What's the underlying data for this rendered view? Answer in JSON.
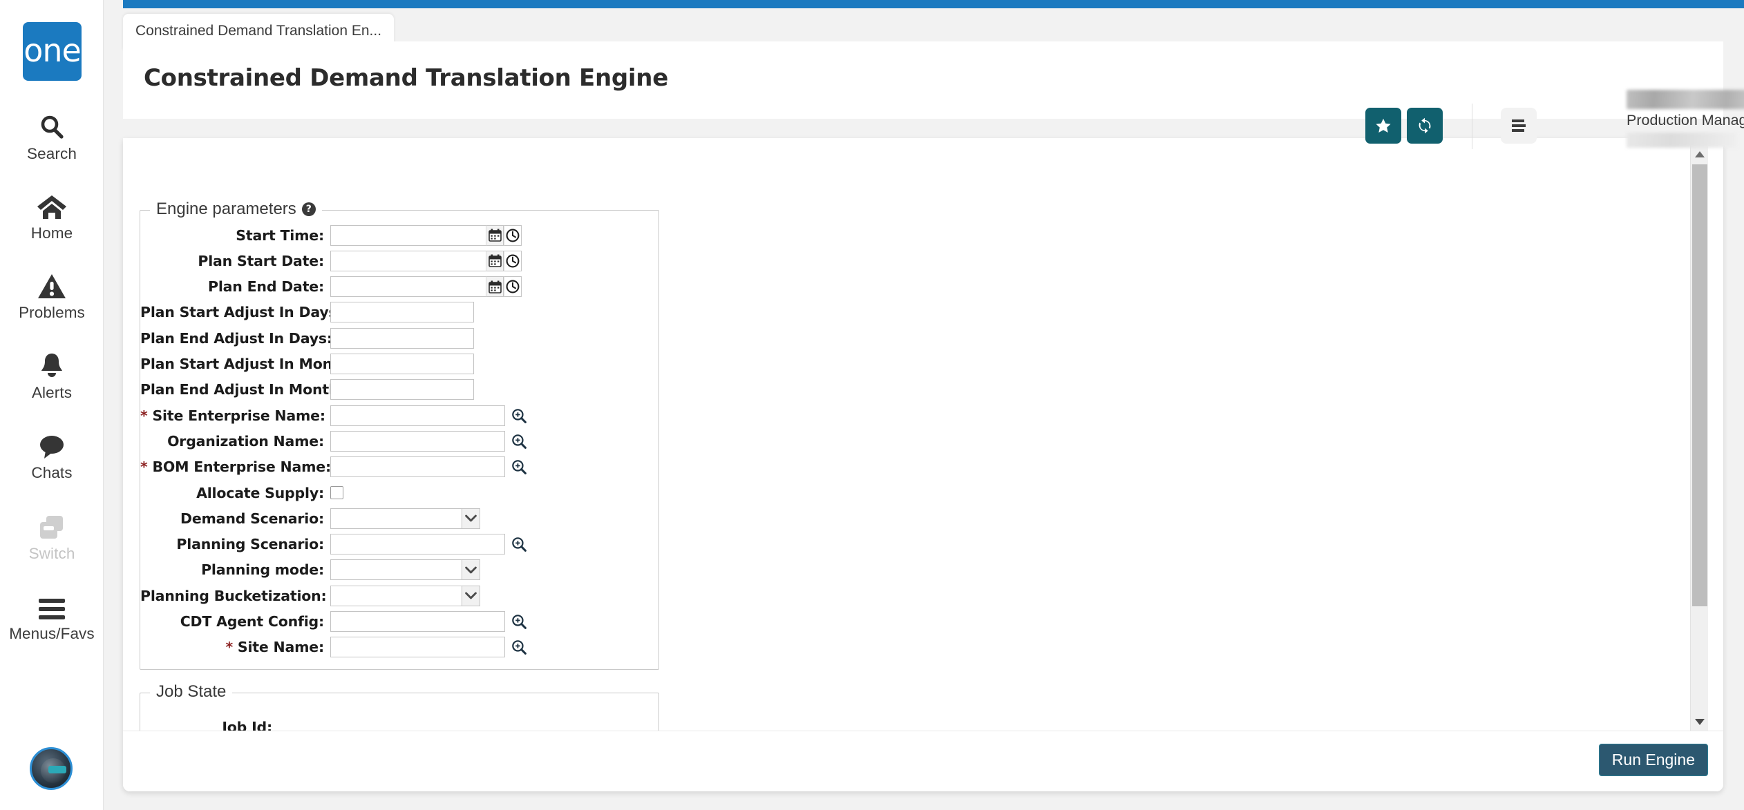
{
  "brand": {
    "logo_text": "one"
  },
  "sidebar": {
    "items": [
      {
        "label": "Search",
        "icon": "search-icon",
        "disabled": false
      },
      {
        "label": "Home",
        "icon": "home-icon",
        "disabled": false
      },
      {
        "label": "Problems",
        "icon": "warning-icon",
        "disabled": false
      },
      {
        "label": "Alerts",
        "icon": "bell-icon",
        "disabled": false
      },
      {
        "label": "Chats",
        "icon": "chat-icon",
        "disabled": false
      },
      {
        "label": "Switch",
        "icon": "switch-icon",
        "disabled": true
      },
      {
        "label": "Menus/Favs",
        "icon": "hamburger-icon",
        "disabled": false
      }
    ]
  },
  "tabs": [
    {
      "label": "Constrained Demand Translation En...",
      "active": true
    }
  ],
  "header": {
    "title": "Constrained Demand Translation Engine",
    "favorite_icon": "star-icon",
    "refresh_icon": "refresh-icon",
    "menu_icon": "list-menu-icon",
    "user_role": "Production Manager",
    "user_caret_icon": "chevron-down-icon"
  },
  "colors": {
    "top_strip": "#1b7ac0",
    "brand_blue": "#1b7ac0",
    "accent_teal": "#11606e",
    "tab_underline": "#0d6270",
    "run_button_bg": "#2c5870",
    "required_star": "#8a1d1d"
  },
  "form": {
    "engine_legend": "Engine parameters",
    "engine_help_icon": "help-icon",
    "job_legend": "Job State",
    "fields": [
      {
        "label": "Start Time:",
        "required": false,
        "type": "datetime",
        "value": ""
      },
      {
        "label": "Plan Start Date:",
        "required": false,
        "type": "datetime",
        "value": ""
      },
      {
        "label": "Plan End Date:",
        "required": false,
        "type": "datetime",
        "value": ""
      },
      {
        "label": "Plan Start Adjust In Days:",
        "required": false,
        "type": "text-short",
        "value": ""
      },
      {
        "label": "Plan End Adjust In Days:",
        "required": false,
        "type": "text-short",
        "value": ""
      },
      {
        "label": "Plan Start Adjust In Months:",
        "required": false,
        "type": "text-short",
        "value": ""
      },
      {
        "label": "Plan End Adjust In Months:",
        "required": false,
        "type": "text-short",
        "value": ""
      },
      {
        "label": "Site Enterprise Name:",
        "required": true,
        "type": "lookup",
        "value": ""
      },
      {
        "label": "Organization Name:",
        "required": false,
        "type": "lookup",
        "value": ""
      },
      {
        "label": "BOM Enterprise Name:",
        "required": true,
        "type": "lookup",
        "value": ""
      },
      {
        "label": "Allocate Supply:",
        "required": false,
        "type": "checkbox",
        "checked": false
      },
      {
        "label": "Demand Scenario:",
        "required": false,
        "type": "select",
        "value": ""
      },
      {
        "label": "Planning Scenario:",
        "required": false,
        "type": "lookup",
        "value": ""
      },
      {
        "label": "Planning mode:",
        "required": false,
        "type": "select",
        "value": ""
      },
      {
        "label": "Planning Bucketization:",
        "required": false,
        "type": "select",
        "value": ""
      },
      {
        "label": "CDT Agent Config:",
        "required": false,
        "type": "lookup",
        "value": ""
      },
      {
        "label": "Site Name:",
        "required": true,
        "type": "lookup",
        "value": ""
      }
    ],
    "job_fields": [
      {
        "label": "Job Id:",
        "value": ""
      }
    ]
  },
  "footer": {
    "run_label": "Run Engine"
  },
  "scrollbar": {
    "up_icon": "caret-up-icon",
    "down_icon": "caret-down-icon"
  }
}
